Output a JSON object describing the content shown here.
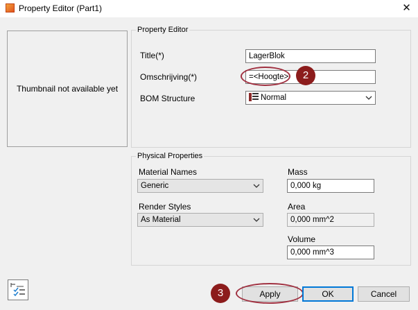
{
  "window": {
    "title": "Property Editor (Part1)",
    "close_glyph": "✕"
  },
  "thumbnail": {
    "text": "Thumbnail not available yet"
  },
  "property_editor": {
    "legend": "Property Editor",
    "title_label": "Title(*)",
    "title_value": "LagerBlok",
    "description_label": "Omschrijving(*)",
    "description_value": "=<Hoogte>",
    "bom_label": "BOM Structure",
    "bom_value": "Normal",
    "bom_icon": "bom-structure-icon"
  },
  "physical": {
    "legend": "Physical Properties",
    "material_label": "Material Names",
    "material_value": "Generic",
    "render_label": "Render Styles",
    "render_value": "As Material",
    "mass_label": "Mass",
    "mass_value": "0,000 kg",
    "area_label": "Area",
    "area_value": "0,000 mm^2",
    "volume_label": "Volume",
    "volume_value": "0,000 mm^3"
  },
  "annotations": {
    "step2": "2",
    "step3": "3",
    "color": "#8c1c1c"
  },
  "buttons": {
    "apply": "Apply",
    "ok": "OK",
    "cancel": "Cancel"
  }
}
